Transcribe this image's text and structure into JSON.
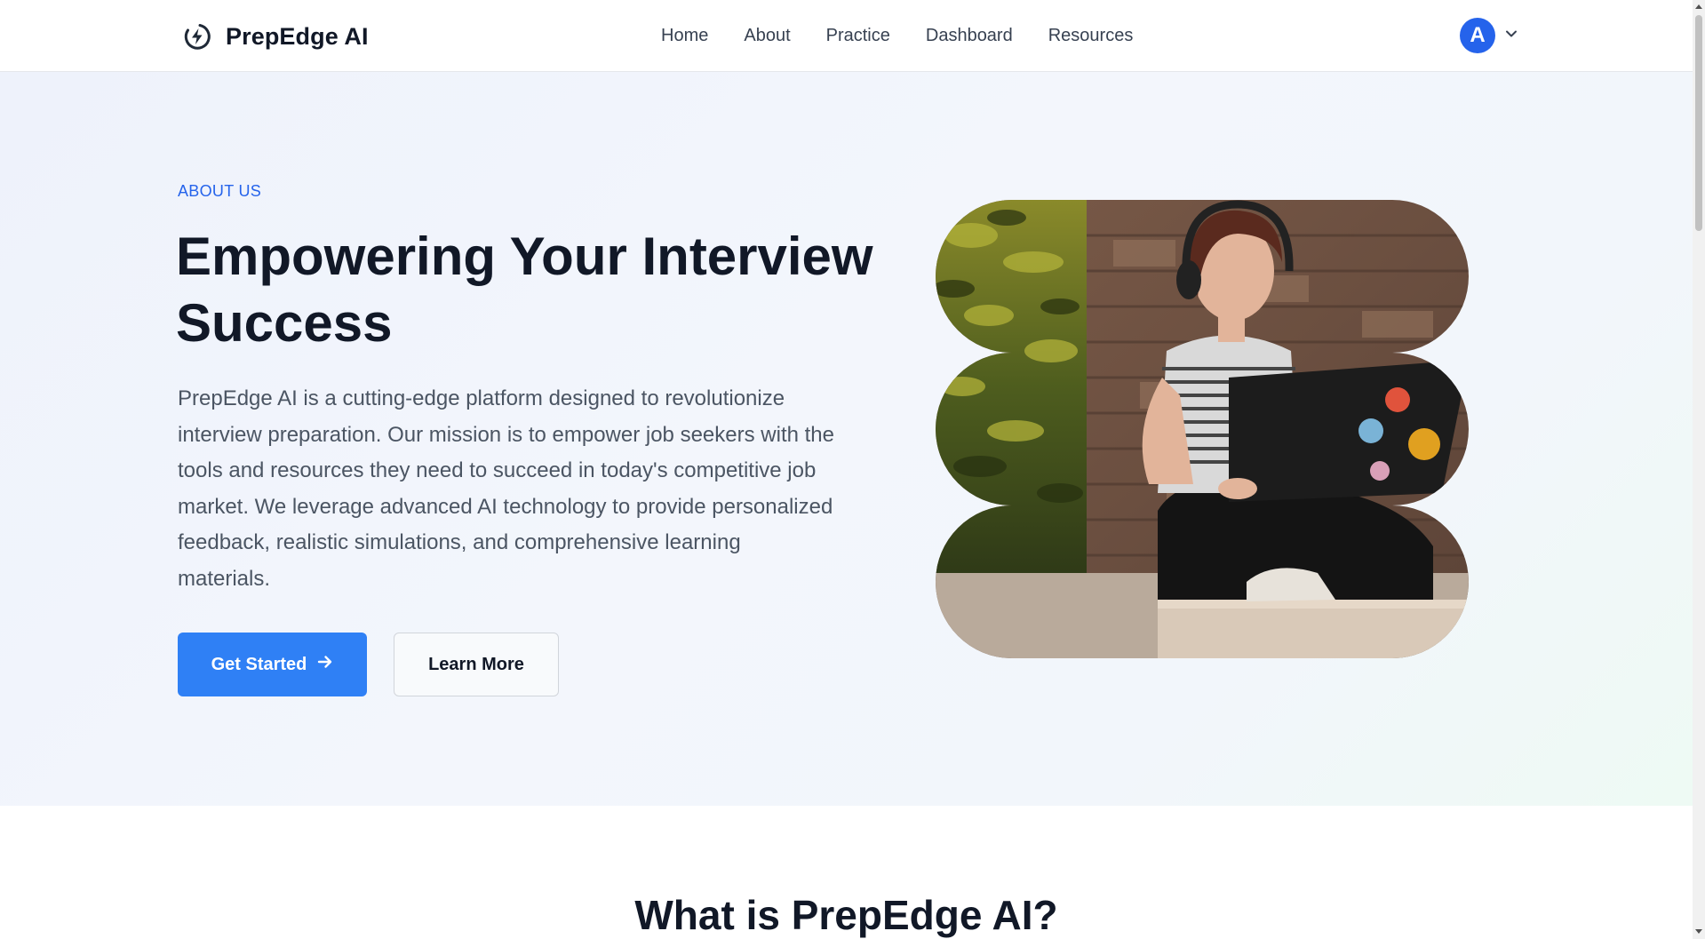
{
  "brand": {
    "name": "PrepEdge AI",
    "logo_icon": "spark-circle-icon"
  },
  "nav": {
    "items": [
      {
        "label": "Home"
      },
      {
        "label": "About"
      },
      {
        "label": "Practice"
      },
      {
        "label": "Dashboard"
      },
      {
        "label": "Resources"
      }
    ]
  },
  "user": {
    "initial": "A",
    "menu_icon": "chevron-down-icon"
  },
  "hero": {
    "eyebrow": "ABOUT US",
    "title": "Empowering Your Interview Success",
    "description": "PrepEdge AI is a cutting-edge platform designed to revolutionize interview preparation. Our mission is to empower job seekers with the tools and resources they need to succeed in today's competitive job market. We leverage advanced AI technology to provide personalized feedback, realistic simulations, and comprehensive learning materials.",
    "primary_button": "Get Started",
    "primary_button_icon": "arrow-right-icon",
    "secondary_button": "Learn More"
  },
  "section": {
    "title": "What is PrepEdge AI?"
  },
  "colors": {
    "accent": "#2f80f5",
    "eyebrow": "#2563eb",
    "avatar": "#2563eb"
  }
}
